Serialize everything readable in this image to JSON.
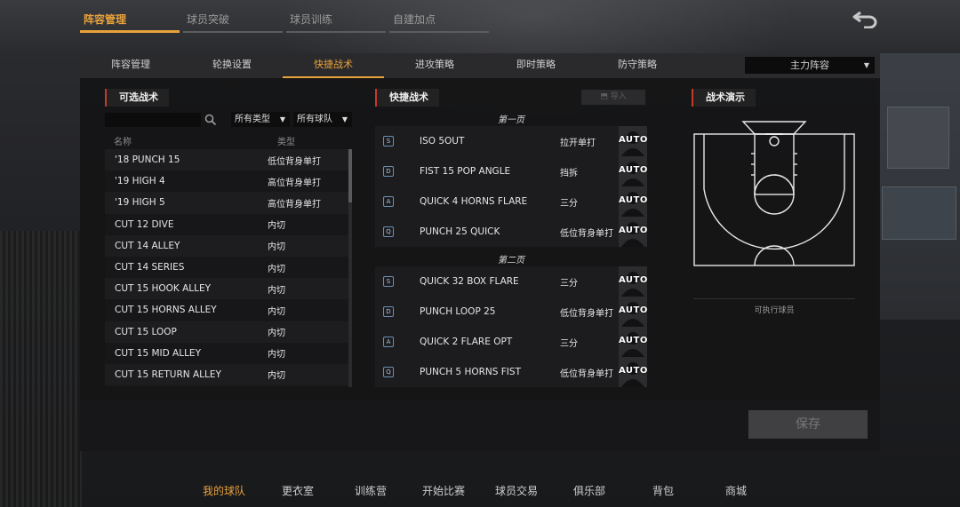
{
  "top_tabs": [
    {
      "label": "阵容管理",
      "active": true
    },
    {
      "label": "球员突破",
      "active": false
    },
    {
      "label": "球员训练",
      "active": false
    },
    {
      "label": "自建加点",
      "active": false
    }
  ],
  "sub_tabs": [
    {
      "label": "阵容管理",
      "active": false
    },
    {
      "label": "轮换设置",
      "active": false
    },
    {
      "label": "快捷战术",
      "active": true
    },
    {
      "label": "进攻策略",
      "active": false
    },
    {
      "label": "即时策略",
      "active": false
    },
    {
      "label": "防守策略",
      "active": false
    }
  ],
  "lineup_select": {
    "value": "主力阵容"
  },
  "available": {
    "title": "可选战术",
    "search_placeholder": "",
    "type_filter": "所有类型",
    "team_filter": "所有球队",
    "col_name": "名称",
    "col_type": "类型",
    "rows": [
      {
        "name": "'18 PUNCH 15",
        "type": "低位背身单打"
      },
      {
        "name": "'19 HIGH 4",
        "type": "高位背身单打"
      },
      {
        "name": "'19 HIGH 5",
        "type": "高位背身单打"
      },
      {
        "name": "CUT 12 DIVE",
        "type": "内切"
      },
      {
        "name": "CUT 14 ALLEY",
        "type": "内切"
      },
      {
        "name": "CUT 14 SERIES",
        "type": "内切"
      },
      {
        "name": "CUT 15 HOOK ALLEY",
        "type": "内切"
      },
      {
        "name": "CUT 15 HORNS ALLEY",
        "type": "内切"
      },
      {
        "name": "CUT 15 LOOP",
        "type": "内切"
      },
      {
        "name": "CUT 15 MID ALLEY",
        "type": "内切"
      },
      {
        "name": "CUT 15 RETURN ALLEY",
        "type": "内切"
      }
    ]
  },
  "quick": {
    "title": "快捷战术",
    "import_label": "导入",
    "page1_label": "第一页",
    "page2_label": "第二页",
    "auto_label": "AUTO",
    "page1": [
      {
        "key": "S",
        "name": "ISO 5OUT",
        "type": "拉开单打"
      },
      {
        "key": "D",
        "name": "FIST 15 POP ANGLE",
        "type": "挡拆"
      },
      {
        "key": "A",
        "name": "QUICK 4 HORNS FLARE",
        "type": "三分"
      },
      {
        "key": "Q",
        "name": "PUNCH 25 QUICK",
        "type": "低位背身单打"
      }
    ],
    "page2": [
      {
        "key": "S",
        "name": "QUICK 32 BOX FLARE",
        "type": "三分"
      },
      {
        "key": "D",
        "name": "PUNCH LOOP 25",
        "type": "低位背身单打"
      },
      {
        "key": "A",
        "name": "QUICK 2 FLARE OPT",
        "type": "三分"
      },
      {
        "key": "Q",
        "name": "PUNCH 5 HORNS FIST",
        "type": "低位背身单打"
      }
    ]
  },
  "demo": {
    "title": "战术演示",
    "exec_label": "可执行球员"
  },
  "save_label": "保存",
  "bottom_nav": [
    {
      "label": "我的球队",
      "active": true
    },
    {
      "label": "更衣室",
      "active": false
    },
    {
      "label": "训练营",
      "active": false
    },
    {
      "label": "开始比赛",
      "active": false
    },
    {
      "label": "球员交易",
      "active": false
    },
    {
      "label": "俱乐部",
      "active": false
    },
    {
      "label": "背包",
      "active": false
    },
    {
      "label": "商城",
      "active": false
    }
  ],
  "colors": {
    "accent": "#e9a23b",
    "section_marker": "#c53b2a",
    "key_border": "#6b8fb3"
  }
}
